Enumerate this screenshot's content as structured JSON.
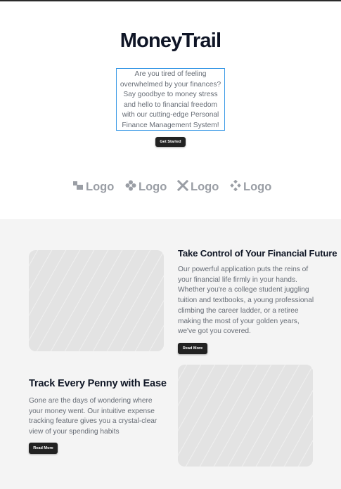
{
  "hero": {
    "brand": "MoneyTrail",
    "tagline": "Are you tired of feeling overwhelmed by your finances? Say goodbye to money stress and hello to financial freedom with our cutting-edge Personal Finance Management System!",
    "cta_label": "Get Started"
  },
  "logos": [
    {
      "icon": "squares-logo-icon",
      "label": "Logo"
    },
    {
      "icon": "clover-logo-icon",
      "label": "Logo"
    },
    {
      "icon": "x-logo-icon",
      "label": "Logo"
    },
    {
      "icon": "diamond-dots-logo-icon",
      "label": "Logo"
    }
  ],
  "features": [
    {
      "title": "Take Control of Your Financial Future",
      "body": "Our powerful application puts the reins of your financial life firmly in your hands. Whether you're a college student juggling tuition and textbooks, a young professional climbing the career ladder, or a retiree making the most of your golden years, we've got you covered.",
      "button": "Read More"
    },
    {
      "title": "Track Every Penny with Ease",
      "body": "Gone are the days of wondering where your money went. Our intuitive expense tracking feature gives you a crystal-clear view of your spending habits",
      "button": "Read More"
    }
  ],
  "colors": {
    "brand_text": "#0f1526",
    "button_bg": "#222222",
    "section_bg": "#f4f4f4",
    "placeholder_bg": "#e3e3e3",
    "focus_outline": "#3b9ae6"
  }
}
